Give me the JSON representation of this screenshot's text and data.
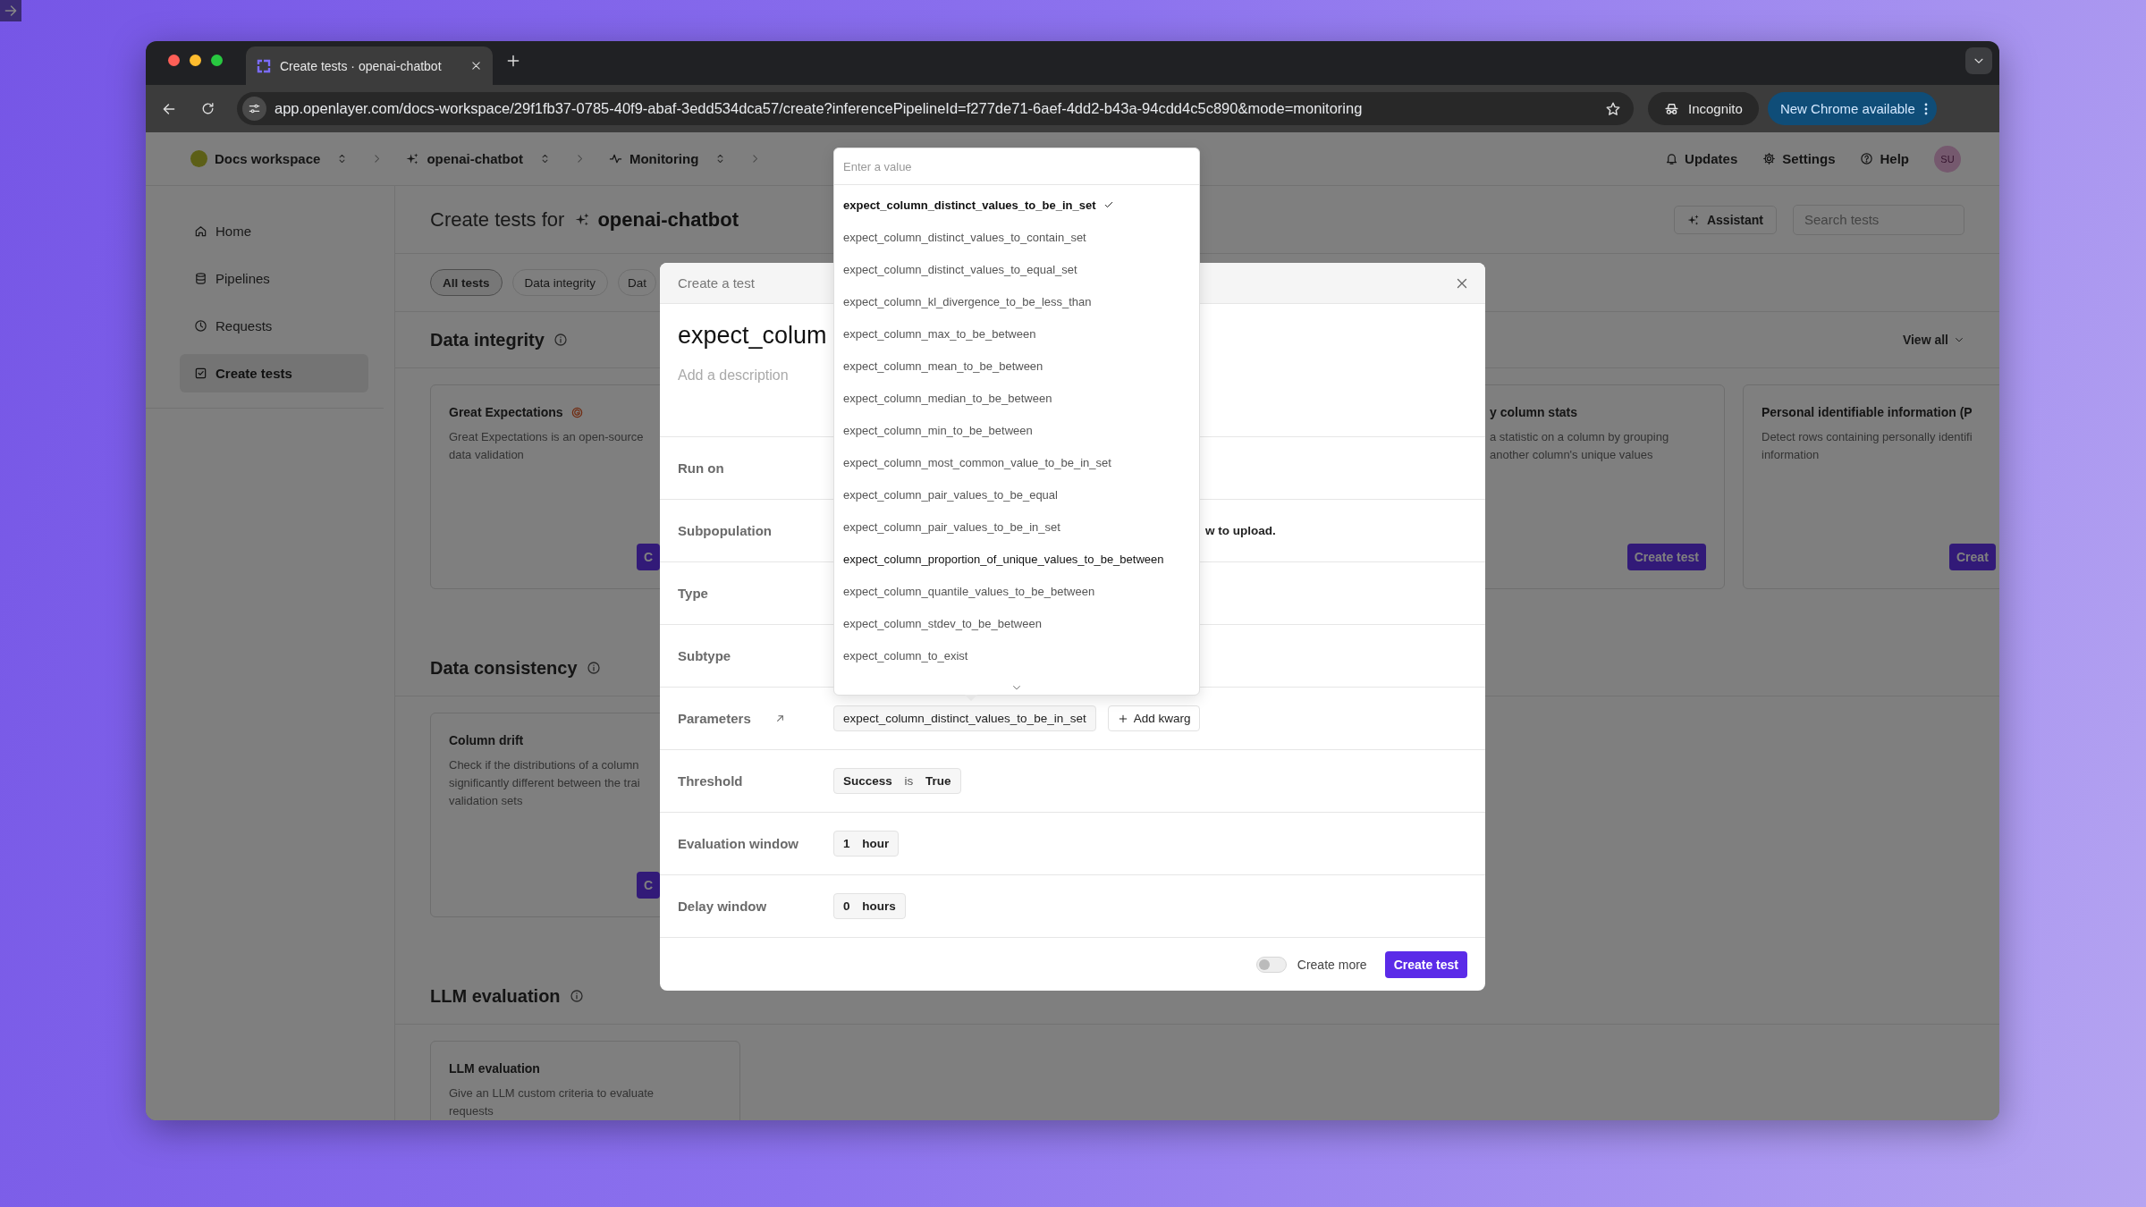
{
  "browser": {
    "tab_title": "Create tests · openai-chatbot",
    "url": "app.openlayer.com/docs-workspace/29f1fb37-0785-40f9-abaf-3edd534dca57/create?inferencePipelineId=f277de71-6aef-4dd2-b43a-94cdd4c5c890&mode=monitoring",
    "incognito": "Incognito",
    "update_button": "New Chrome available"
  },
  "topbar": {
    "breadcrumbs": [
      {
        "kind": "workspace",
        "label": "Docs workspace"
      },
      {
        "kind": "project",
        "label": "openai-chatbot"
      },
      {
        "kind": "monitoring",
        "label": "Monitoring"
      }
    ],
    "actions": [
      {
        "kind": "updates",
        "label": "Updates"
      },
      {
        "kind": "settings",
        "label": "Settings"
      },
      {
        "kind": "help",
        "label": "Help"
      }
    ],
    "avatar": "SU"
  },
  "sidebar": {
    "items": [
      {
        "kind": "home",
        "label": "Home",
        "selected": false
      },
      {
        "kind": "pipelines",
        "label": "Pipelines",
        "selected": false
      },
      {
        "kind": "requests",
        "label": "Requests",
        "selected": false
      },
      {
        "kind": "create",
        "label": "Create tests",
        "selected": true
      }
    ]
  },
  "header": {
    "title": "Create tests for",
    "project": "openai-chatbot",
    "assistant_button": "Assistant",
    "search": {
      "placeholder": "Search tests"
    }
  },
  "filters": [
    {
      "label": "All tests",
      "selected": true
    },
    {
      "label": "Data integrity",
      "selected": false
    },
    {
      "label": "Dat",
      "selected": false
    }
  ],
  "sections": [
    {
      "title": "Data integrity",
      "view_all": "View all",
      "cards": [
        {
          "title": "Great Expectations",
          "logo": true,
          "kind": "partial_end",
          "description": [
            "Great Expectations is an open-source",
            "data validation"
          ],
          "button": "C"
        },
        {
          "title": "y column stats",
          "logo": false,
          "kind": "partial_start",
          "description": [
            "a statistic on a column by grouping",
            "another column's unique values"
          ],
          "button": "Create test"
        },
        {
          "title": "Personal identifiable information (P",
          "logo": false,
          "kind": "partial_end",
          "description": [
            "Detect rows containing personally identifi",
            "information"
          ],
          "button": "Creat"
        }
      ]
    },
    {
      "title": "Data consistency",
      "cards": [
        {
          "title": "Column drift",
          "logo": false,
          "kind": "partial_end",
          "description": [
            "Check if the distributions of a column",
            "significantly different between the trai",
            "validation sets"
          ],
          "button": "C"
        }
      ]
    },
    {
      "title": "LLM evaluation",
      "cards": [
        {
          "title": "LLM evaluation",
          "logo": false,
          "kind": "full",
          "description": [
            "Give an LLM custom criteria to evaluate",
            "requests"
          ]
        }
      ]
    }
  ],
  "modal": {
    "title": "Create a test",
    "name": "expect_colum",
    "description_placeholder": "Add a description",
    "rows": [
      {
        "kind": "empty",
        "label": "Run on"
      },
      {
        "kind": "text",
        "label": "Subpopulation",
        "value": "w to upload."
      },
      {
        "kind": "empty",
        "label": "Type"
      },
      {
        "kind": "empty",
        "label": "Subtype"
      },
      {
        "kind": "parameters",
        "label": "Parameters",
        "value": "expect_column_distinct_values_to_be_in_set",
        "add_button": "Add kwarg"
      },
      {
        "kind": "segments",
        "label": "Threshold",
        "parts": [
          "Success",
          "is",
          "True"
        ]
      },
      {
        "kind": "segments",
        "label": "Evaluation window",
        "parts": [
          "1",
          "hour"
        ]
      },
      {
        "kind": "segments",
        "label": "Delay window",
        "parts": [
          "0",
          "hours"
        ]
      }
    ],
    "create_more": {
      "label": "Create more",
      "on": false
    },
    "submit_button": "Create test"
  },
  "dropdown": {
    "placeholder": "Enter a value",
    "options": [
      {
        "label": "expect_column_distinct_values_to_be_in_set",
        "selected": true,
        "hovered": false
      },
      {
        "label": "expect_column_distinct_values_to_contain_set",
        "selected": false,
        "hovered": false
      },
      {
        "label": "expect_column_distinct_values_to_equal_set",
        "selected": false,
        "hovered": false
      },
      {
        "label": "expect_column_kl_divergence_to_be_less_than",
        "selected": false,
        "hovered": false
      },
      {
        "label": "expect_column_max_to_be_between",
        "selected": false,
        "hovered": false
      },
      {
        "label": "expect_column_mean_to_be_between",
        "selected": false,
        "hovered": false
      },
      {
        "label": "expect_column_median_to_be_between",
        "selected": false,
        "hovered": false
      },
      {
        "label": "expect_column_min_to_be_between",
        "selected": false,
        "hovered": false
      },
      {
        "label": "expect_column_most_common_value_to_be_in_set",
        "selected": false,
        "hovered": false
      },
      {
        "label": "expect_column_pair_values_to_be_equal",
        "selected": false,
        "hovered": false
      },
      {
        "label": "expect_column_pair_values_to_be_in_set",
        "selected": false,
        "hovered": false
      },
      {
        "label": "expect_column_proportion_of_unique_values_to_be_between",
        "selected": false,
        "hovered": true
      },
      {
        "label": "expect_column_quantile_values_to_be_between",
        "selected": false,
        "hovered": false
      },
      {
        "label": "expect_column_stdev_to_be_between",
        "selected": false,
        "hovered": false
      },
      {
        "label": "expect_column_to_exist",
        "selected": false,
        "hovered": false
      }
    ]
  }
}
